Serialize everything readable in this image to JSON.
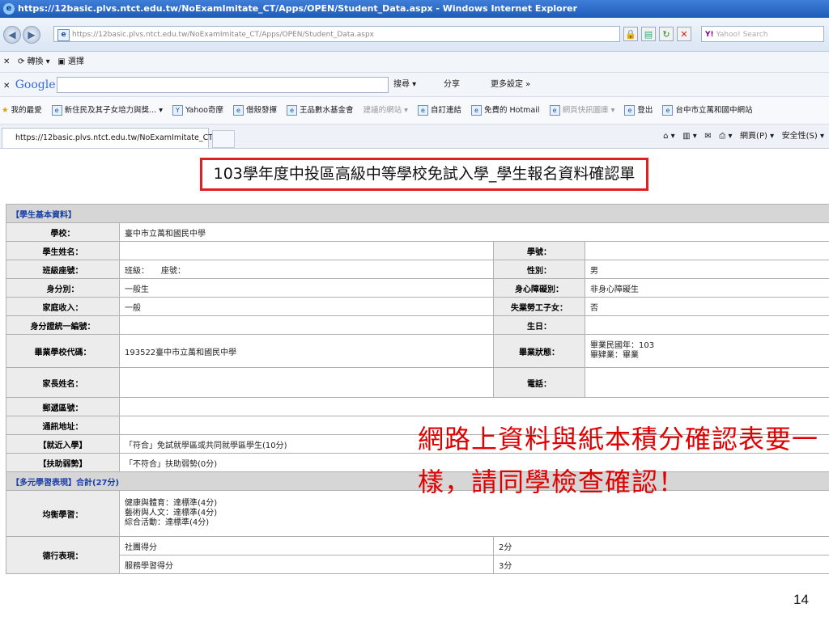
{
  "window": {
    "title": "https://12basic.plvs.ntct.edu.tw/NoExamImitate_CT/Apps/OPEN/Student_Data.aspx - Windows Internet Explorer",
    "address": "https://12basic.plvs.ntct.edu.tw/NoExamImitate_CT/Apps/OPEN/Student_Data.aspx",
    "search_placeholder": "Yahoo! Search"
  },
  "translate_bar": {
    "translate": "轉換",
    "select": "選擇"
  },
  "google_bar": {
    "logo": "Google",
    "search": "搜尋",
    "share": "分享",
    "more": "更多設定 »"
  },
  "favorites_bar": {
    "label": "我的最愛",
    "items": [
      "新住民及其子女培力與獎...",
      "Yahoo奇摩",
      "借殼發揮",
      "王品數水基金會",
      "建議的網站",
      "自訂連結",
      "免費的 Hotmail",
      "網頁快訊圖庫",
      "登出",
      "台中市立萬和國中網站"
    ]
  },
  "tab": {
    "label": "https://12basic.plvs.ntct.edu.tw/NoExamImitate_CT/Ap..."
  },
  "commands": {
    "page": "網頁(P)",
    "safety": "安全性(S)"
  },
  "doc_title": "103學年度中投區高級中等學校免試入學_學生報名資料確認單",
  "sections": {
    "basic": "【學生基本資料】",
    "multi": "【多元學習表現】合計(27分)"
  },
  "fields": {
    "school_label": "學校：",
    "school_value": "臺中市立萬和國民中學",
    "name_label": "學生姓名：",
    "student_no_label": "學號：",
    "class_label": "班級座號：",
    "class_value": "班級：　　座號：",
    "gender_label": "性別：",
    "gender_value": "男",
    "identity_label": "身分別：",
    "identity_value": "一般生",
    "disability_label": "身心障礙別：",
    "disability_value": "非身心障礙生",
    "income_label": "家庭收入：",
    "income_value": "一般",
    "unemployed_label": "失業勞工子女：",
    "unemployed_value": "否",
    "id_label": "身分證統一編號：",
    "birthday_label": "生日：",
    "grad_code_label": "畢業學校代碼：",
    "grad_code_value": "193522臺中市立萬和國民中學",
    "grad_status_label": "畢業狀態：",
    "grad_status_value": "畢業民國年：103\n畢肄業：畢業",
    "parent_label": "家長姓名：",
    "phone_label": "電話：",
    "zip_label": "郵遞區號：",
    "address_label": "通訊地址：",
    "nearby_label": "【就近入學】",
    "nearby_value": "「符合」免試就學區或共同就學區學生(10分)",
    "assist_label": "【扶助弱勢】",
    "assist_value": "「不符合」扶助弱勢(0分)",
    "balance_label": "均衡學習：",
    "balance_value": "健康與體育：達標準(4分)\n藝術與人文：達標準(4分)\n綜合活動：達標準(4分)",
    "virtue_label": "德行表現：",
    "virtue_row1_label": "社團得分",
    "virtue_row1_value": "2分",
    "virtue_row2_label": "服務學習得分",
    "virtue_row2_value": "3分"
  },
  "callout": "網路上資料與紙本積分確認表要一樣，請同學檢查確認！",
  "page_number": "14"
}
